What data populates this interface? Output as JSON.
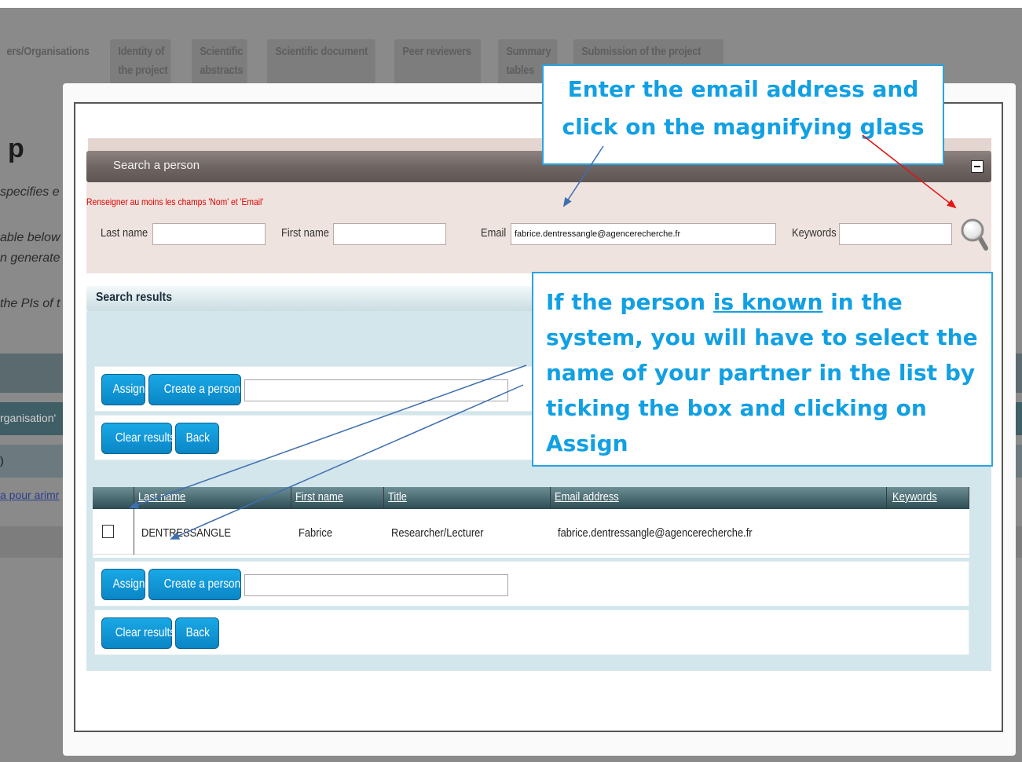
{
  "background": {
    "tabs": [
      {
        "label": "ers/Organisations",
        "sub": ""
      },
      {
        "label": "Identity of",
        "sub": "the project"
      },
      {
        "label": "Scientific",
        "sub": "abstracts"
      },
      {
        "label": "Scientific document",
        "sub": ""
      },
      {
        "label": "Peer reviewers",
        "sub": ""
      },
      {
        "label": "Summary",
        "sub": "tables"
      },
      {
        "label": "Submission of the project",
        "sub": ""
      }
    ],
    "heading": "p",
    "text_lines": [
      "specifies e",
      "able below",
      "n generate",
      "the PIs of t"
    ],
    "band_text": "rganisation'",
    "row_text": ")",
    "link_text": "a pour arimr"
  },
  "modal": {
    "search_title": "Search a person",
    "warning": "Renseigner au moins les champs 'Nom' et 'Email'",
    "labels": {
      "last_name": "Last name",
      "first_name": "First name",
      "email": "Email",
      "keywords": "Keywords"
    },
    "values": {
      "last_name": "",
      "first_name": "",
      "email": "fabrice.dentressangle@agencerecherche.fr",
      "keywords": ""
    },
    "results_title": "Search results",
    "buttons": {
      "assign": "Assign",
      "create": "Create a person",
      "clear": "Clear results",
      "back": "Back"
    },
    "table": {
      "headers": [
        "Last name",
        "First name",
        "Title",
        "Email address",
        "Keywords"
      ],
      "rows": [
        {
          "last_name": "DENTRESSANGLE",
          "first_name": "Fabrice",
          "title": "Researcher/Lecturer",
          "email": "fabrice.dentressangle@agencerecherche.fr",
          "keywords": ""
        }
      ]
    }
  },
  "callouts": {
    "first_line1": "Enter the email address and",
    "first_line2": "click on the magnifying glass",
    "second_pre": "If the person ",
    "second_ul": "is known",
    "second_post": " in the",
    "second_line2": "system, you will have to select the",
    "second_line3": "name of your partner in the list by",
    "second_line4": "ticking the box and clicking on",
    "second_line5": "Assign"
  },
  "colors": {
    "accent_button": "#0a86c6",
    "callout_text": "#12a0e3",
    "warning": "#e30000"
  }
}
